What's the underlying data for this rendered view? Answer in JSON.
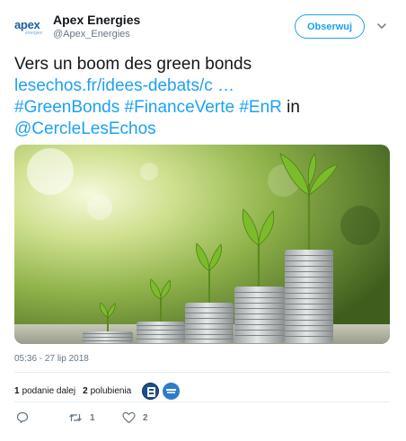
{
  "author": {
    "display_name": "Apex Energies",
    "handle": "@Apex_Energies",
    "logo_text": "apex",
    "logo_subtext": "énergies"
  },
  "follow_label": "Obserwuj",
  "tweet": {
    "lines": [
      {
        "text": "Vers un boom des green bonds"
      },
      {
        "link": "lesechos.fr/idees-debats/c … "
      }
    ],
    "hashtags": "#GreenBonds #FinanceVerte #EnR",
    "in_word": " in",
    "mention": "@CercleLesEchos"
  },
  "timestamp": "05:36 - 27 lip 2018",
  "stats": {
    "retweets_count": "1",
    "retweets_label": "podanie dalej",
    "likes_count": "2",
    "likes_label": "polubienia"
  },
  "actions": {
    "reply_count": "",
    "retweet_count": "1",
    "like_count": "2"
  },
  "colors": {
    "link": "#1da1f2",
    "text": "#14171a",
    "muted": "#657786"
  }
}
